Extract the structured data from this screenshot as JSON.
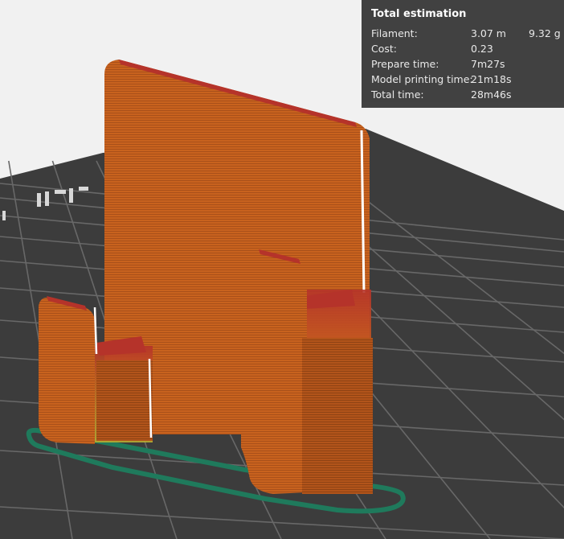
{
  "estimation": {
    "title": "Total estimation",
    "rows": [
      {
        "label": "Filament:",
        "value": "3.07 m",
        "extra": "9.32 g"
      },
      {
        "label": "Cost:",
        "value": "0.23",
        "extra": ""
      },
      {
        "label": "Prepare time:",
        "value": "7m27s",
        "extra": ""
      },
      {
        "label": "Model printing time:",
        "value": "21m18s",
        "extra": ""
      },
      {
        "label": "Total time:",
        "value": "28m46s",
        "extra": ""
      }
    ]
  },
  "scene": {
    "background": "#f1f1f1",
    "plate_color": "#3c3c3c",
    "grid_color": "#6a6a6a",
    "model_color": "#c8621e",
    "top_layer_color": "#b5332a",
    "skirt_color": "#1f7a5c",
    "seam_color": "#ffffff"
  }
}
